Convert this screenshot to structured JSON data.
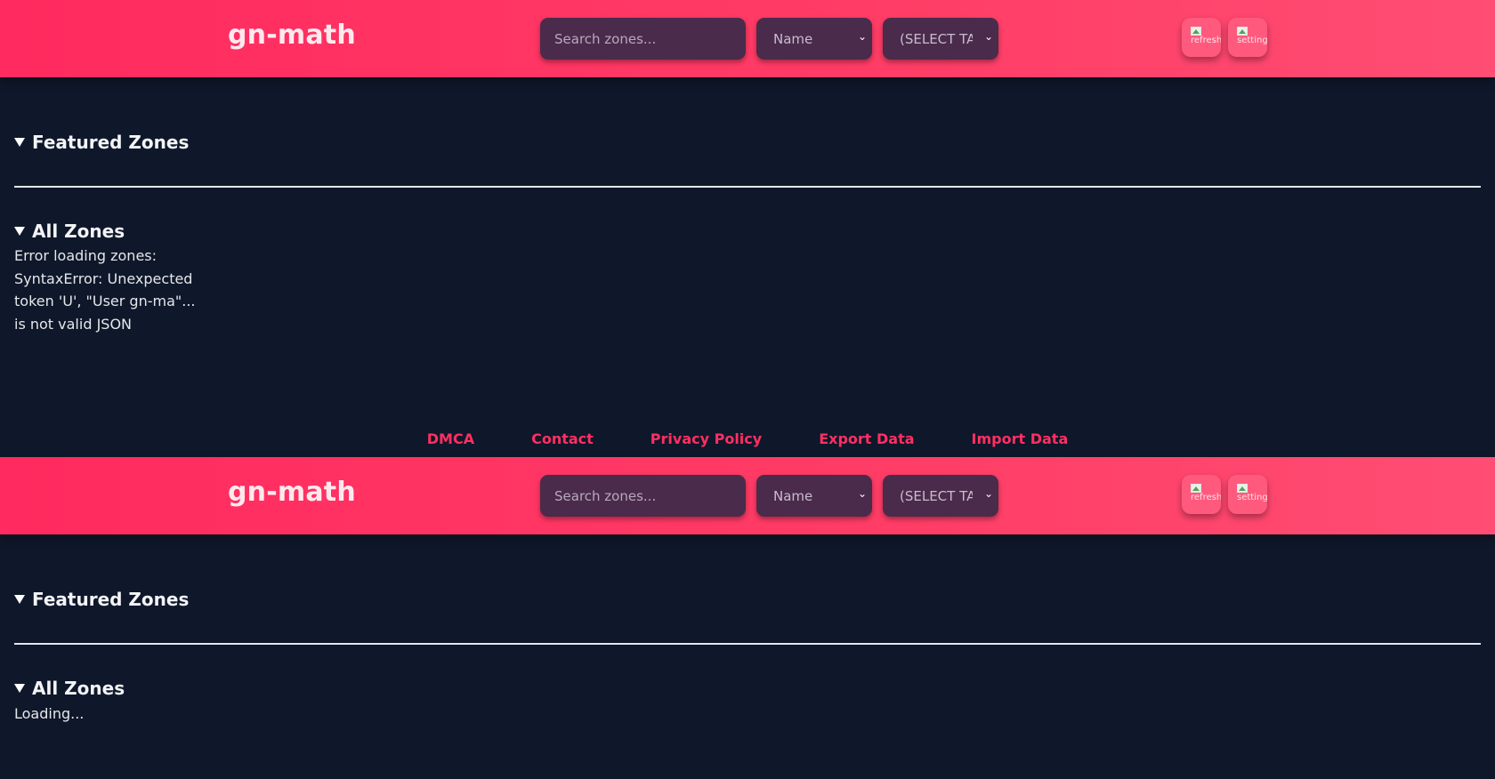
{
  "header": {
    "logo": "gn-math",
    "search_placeholder": "Search zones...",
    "sort_select": "Name",
    "tag_select": "(SELECT TAG)",
    "refresh_icon_alt": "refresh",
    "settings_icon_alt": "settings"
  },
  "sections": {
    "featured_title": "Featured Zones",
    "all_title": "All Zones",
    "error_message": "Error loading zones: SyntaxError: Unexpected token 'U', \"User gn-ma\"... is not valid JSON",
    "loading_message": "Loading..."
  },
  "footer": {
    "links": [
      "DMCA",
      "Contact",
      "Privacy Policy",
      "Export Data",
      "Import Data"
    ]
  },
  "colors": {
    "header_gradient_start": "#ff2a5f",
    "header_gradient_end": "#ff4d73",
    "background": "#0f172a",
    "input_bg": "#4a2b4b",
    "footer_link": "#ff2f62"
  },
  "icons": [
    "refresh-icon",
    "settings-icon",
    "triangle-down-icon"
  ]
}
